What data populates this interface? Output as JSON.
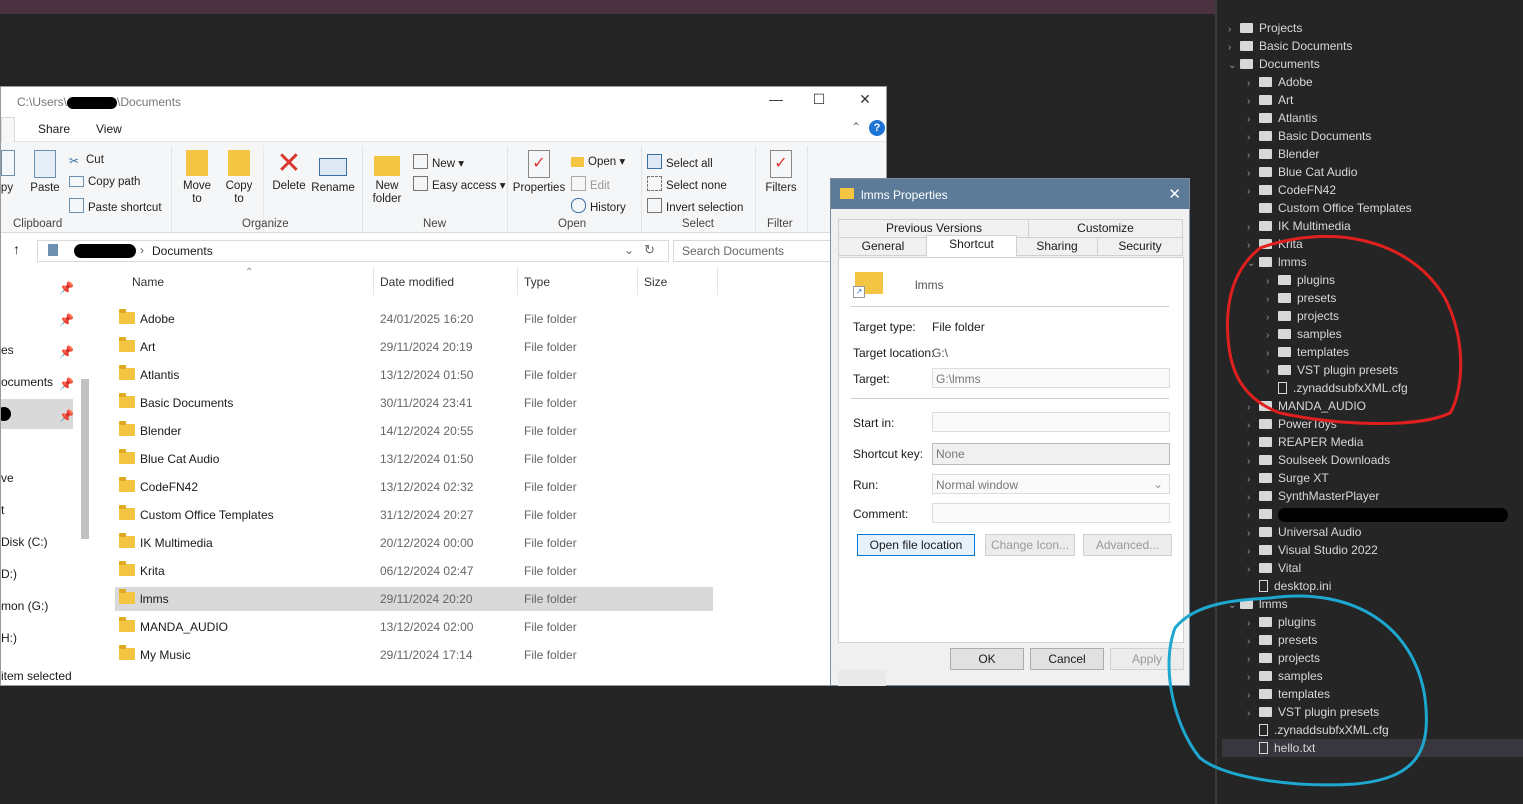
{
  "explorer": {
    "path_prefix": "C:\\Users\\",
    "path_suffix": "\\Documents",
    "tabs": [
      "Share",
      "View"
    ],
    "ribbon": {
      "clipboard": {
        "copy": "py",
        "paste": "Paste",
        "cut": "Cut",
        "copy_path": "Copy path",
        "paste_shortcut": "Paste shortcut",
        "label": "Clipboard"
      },
      "organize": {
        "move_to": "Move\nto",
        "copy_to": "Copy\nto",
        "delete": "Delete",
        "rename": "Rename",
        "label": "Organize"
      },
      "new": {
        "new_folder": "New\nfolder",
        "new_item": "New",
        "easy_access": "Easy access",
        "label": "New"
      },
      "open": {
        "properties": "Properties",
        "open": "Open",
        "edit": "Edit",
        "history": "History",
        "label": "Open"
      },
      "select": {
        "select_all": "Select all",
        "select_none": "Select none",
        "invert": "Invert selection",
        "label": "Select"
      },
      "filter": {
        "filters": "Filters",
        "label": "Filter"
      }
    },
    "address": {
      "crumb": "Documents",
      "search_placeholder": "Search Documents"
    },
    "nav": [
      "es",
      "ocuments",
      "ve",
      "t",
      "Disk (C:)",
      "D:)",
      "mon (G:)",
      "H:)"
    ],
    "columns": {
      "name": "Name",
      "date": "Date modified",
      "type": "Type",
      "size": "Size"
    },
    "rows": [
      {
        "name": "Adobe",
        "date": "24/01/2025 16:20",
        "type": "File folder"
      },
      {
        "name": "Art",
        "date": "29/11/2024 20:19",
        "type": "File folder"
      },
      {
        "name": "Atlantis",
        "date": "13/12/2024 01:50",
        "type": "File folder"
      },
      {
        "name": "Basic Documents",
        "date": "30/11/2024 23:41",
        "type": "File folder"
      },
      {
        "name": "Blender",
        "date": "14/12/2024 20:55",
        "type": "File folder"
      },
      {
        "name": "Blue Cat Audio",
        "date": "13/12/2024 01:50",
        "type": "File folder"
      },
      {
        "name": "CodeFN42",
        "date": "13/12/2024 02:32",
        "type": "File folder"
      },
      {
        "name": "Custom Office Templates",
        "date": "31/12/2024 20:27",
        "type": "File folder"
      },
      {
        "name": "IK Multimedia",
        "date": "20/12/2024 00:00",
        "type": "File folder"
      },
      {
        "name": "Krita",
        "date": "06/12/2024 02:47",
        "type": "File folder"
      },
      {
        "name": "lmms",
        "date": "29/11/2024 20:20",
        "type": "File folder"
      },
      {
        "name": "MANDA_AUDIO",
        "date": "13/12/2024 02:00",
        "type": "File folder"
      },
      {
        "name": "My Music",
        "date": "29/11/2024 17:14",
        "type": "File folder"
      }
    ],
    "status": "item selected"
  },
  "props": {
    "title": "lmms Properties",
    "tabs_top": [
      "Previous Versions",
      "Customize"
    ],
    "tabs_bottom": [
      "General",
      "Shortcut",
      "Sharing",
      "Security"
    ],
    "name": "lmms",
    "target_type_label": "Target type:",
    "target_type": "File folder",
    "target_location_label": "Target location:",
    "target_location": "G:\\",
    "target_label": "Target:",
    "target": "G:\\lmms",
    "start_in_label": "Start in:",
    "shortcut_key_label": "Shortcut key:",
    "shortcut_key": "None",
    "run_label": "Run:",
    "run": "Normal window",
    "comment_label": "Comment:",
    "open_location": "Open file location",
    "change_icon": "Change Icon...",
    "advanced": "Advanced...",
    "ok": "OK",
    "cancel": "Cancel",
    "apply": "Apply"
  },
  "tree": {
    "top": [
      {
        "label": "Projects",
        "level": 0,
        "kind": "proj"
      },
      {
        "label": "Basic Documents",
        "level": 0,
        "kind": "proj"
      },
      {
        "label": "Documents",
        "level": 0,
        "kind": "proj",
        "open": true
      },
      {
        "label": "Adobe",
        "level": 1,
        "kind": "folder"
      },
      {
        "label": "Art",
        "level": 1,
        "kind": "folder"
      },
      {
        "label": "Atlantis",
        "level": 1,
        "kind": "folder"
      },
      {
        "label": "Basic Documents",
        "level": 1,
        "kind": "folder"
      },
      {
        "label": "Blender",
        "level": 1,
        "kind": "folder"
      },
      {
        "label": "Blue Cat Audio",
        "level": 1,
        "kind": "folder"
      },
      {
        "label": "CodeFN42",
        "level": 1,
        "kind": "folder"
      },
      {
        "label": "Custom Office Templates",
        "level": 1,
        "kind": "folder",
        "nochev": true
      },
      {
        "label": "IK Multimedia",
        "level": 1,
        "kind": "folder"
      },
      {
        "label": "Krita",
        "level": 1,
        "kind": "folder"
      },
      {
        "label": "lmms",
        "level": 1,
        "kind": "folder",
        "open": true
      },
      {
        "label": "plugins",
        "level": 2,
        "kind": "folder"
      },
      {
        "label": "presets",
        "level": 2,
        "kind": "folder"
      },
      {
        "label": "projects",
        "level": 2,
        "kind": "folder"
      },
      {
        "label": "samples",
        "level": 2,
        "kind": "folder"
      },
      {
        "label": "templates",
        "level": 2,
        "kind": "folder"
      },
      {
        "label": "VST plugin presets",
        "level": 2,
        "kind": "folder"
      },
      {
        "label": ".zynaddsubfxXML.cfg",
        "level": 2,
        "kind": "file"
      },
      {
        "label": "MANDA_AUDIO",
        "level": 1,
        "kind": "folder"
      },
      {
        "label": "PowerToys",
        "level": 1,
        "kind": "folder"
      },
      {
        "label": "REAPER Media",
        "level": 1,
        "kind": "folder"
      },
      {
        "label": "Soulseek Downloads",
        "level": 1,
        "kind": "folder"
      },
      {
        "label": "Surge XT",
        "level": 1,
        "kind": "folder"
      },
      {
        "label": "SynthMasterPlayer",
        "level": 1,
        "kind": "folder"
      },
      {
        "label": "",
        "level": 1,
        "kind": "folder",
        "redacted": true
      },
      {
        "label": "Universal Audio",
        "level": 1,
        "kind": "folder"
      },
      {
        "label": "Visual Studio 2022",
        "level": 1,
        "kind": "folder"
      },
      {
        "label": "Vital",
        "level": 1,
        "kind": "folder"
      },
      {
        "label": "desktop.ini",
        "level": 1,
        "kind": "file"
      },
      {
        "label": "lmms",
        "level": 0,
        "kind": "proj",
        "open": true
      },
      {
        "label": "plugins",
        "level": 1,
        "kind": "folder"
      },
      {
        "label": "presets",
        "level": 1,
        "kind": "folder"
      },
      {
        "label": "projects",
        "level": 1,
        "kind": "folder"
      },
      {
        "label": "samples",
        "level": 1,
        "kind": "folder"
      },
      {
        "label": "templates",
        "level": 1,
        "kind": "folder"
      },
      {
        "label": "VST plugin presets",
        "level": 1,
        "kind": "folder"
      },
      {
        "label": ".zynaddsubfxXML.cfg",
        "level": 1,
        "kind": "file"
      },
      {
        "label": "hello.txt",
        "level": 1,
        "kind": "file",
        "selected": true
      }
    ]
  },
  "colors": {
    "red_annotation": "#e0201e",
    "blue_annotation": "#1ea8d0",
    "dialog_title": "#5b7b98",
    "folder": "#f4c542"
  }
}
